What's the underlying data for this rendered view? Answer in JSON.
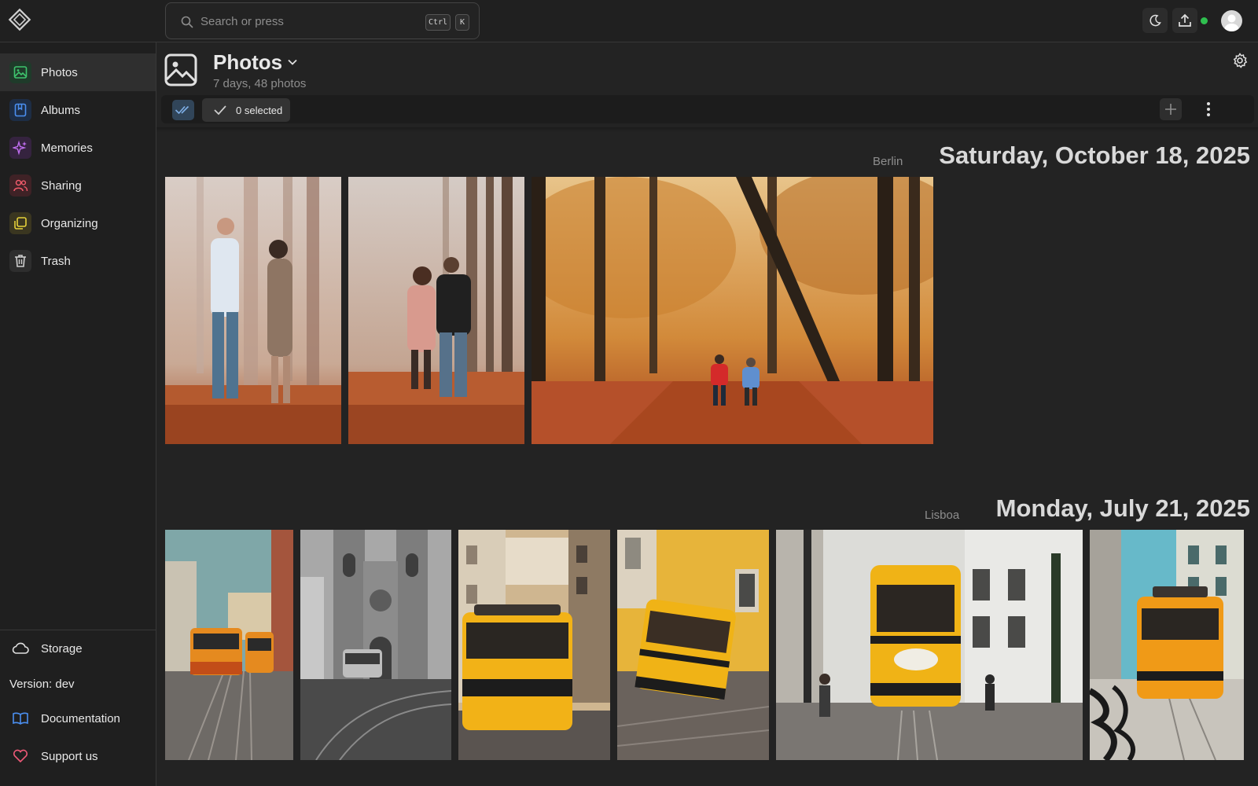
{
  "search": {
    "placeholder": "Search or press",
    "kbd_ctrl": "Ctrl",
    "kbd_k": "K"
  },
  "topbar": {
    "theme_icon": "moon-icon",
    "upload_icon": "upload-icon",
    "status_color": "#2fbf4f"
  },
  "sidebar": {
    "items": [
      {
        "label": "Photos",
        "icon": "image-icon",
        "color": "#3ec46d",
        "active": true
      },
      {
        "label": "Albums",
        "icon": "bookmark-icon",
        "color": "#4b8ff0"
      },
      {
        "label": "Memories",
        "icon": "sparkles-icon",
        "color": "#c06ef0"
      },
      {
        "label": "Sharing",
        "icon": "users-icon",
        "color": "#f05a6a"
      },
      {
        "label": "Organizing",
        "icon": "copy-icon",
        "color": "#e6d23a"
      },
      {
        "label": "Trash",
        "icon": "trash-icon",
        "color": "#cfcfcf"
      }
    ],
    "storage_label": "Storage",
    "version_label": "Version: dev",
    "documentation_label": "Documentation",
    "support_label": "Support us"
  },
  "header": {
    "title": "Photos",
    "subtitle": "7 days, 48 photos"
  },
  "toolbar": {
    "selected_label": "0 selected"
  },
  "days": [
    {
      "title": "Saturday, October 18, 2025",
      "place": "Berlin",
      "photos": [
        "couple-in-foggy-forest",
        "couple-walking-away-forest",
        "autumn-forest-path-hikers"
      ]
    },
    {
      "title": "Monday, July 21, 2025",
      "place": "Lisboa",
      "photos": [
        "lisbon-trams-street",
        "lisbon-cathedral-tram-bw",
        "yellow-tram-narrow-street",
        "yellow-tram-o-lugar-de-portugal",
        "tram-martini-street",
        "tram-mosaic-sidewalk"
      ]
    }
  ]
}
